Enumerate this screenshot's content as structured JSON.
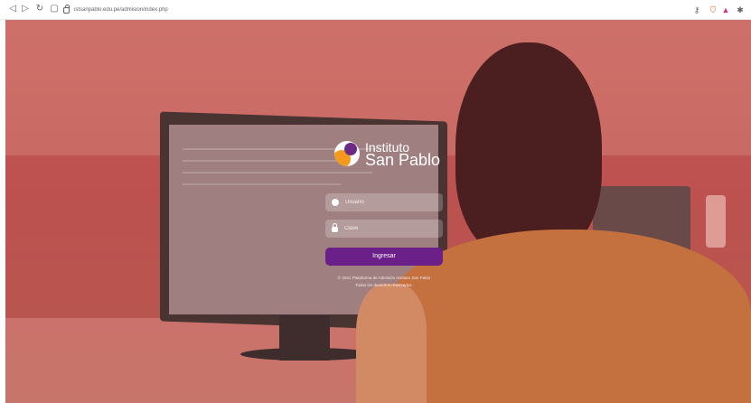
{
  "browser": {
    "url": "istsanpablo.edu.pe/admision/index.php",
    "nav_icons": [
      "back-icon",
      "forward-icon",
      "reload-icon",
      "bookmark-icon"
    ],
    "right_icons": [
      "key-icon",
      "brave-shield-icon",
      "alert-triangle-icon",
      "puzzle-icon"
    ]
  },
  "brand": {
    "line1": "Instituto",
    "line2": "San Pablo",
    "colors": {
      "orange": "#f39a1e",
      "purple": "#6b2b82"
    }
  },
  "form": {
    "usuario_placeholder": "Usuario",
    "clave_placeholder": "Clave",
    "submit_label": "Ingresar",
    "button_color": "#6b1f88"
  },
  "footer": {
    "line1": "© 2021 Plataforma de Admisión Instituto San Pablo",
    "line2": "Todos los derechos reservados."
  }
}
